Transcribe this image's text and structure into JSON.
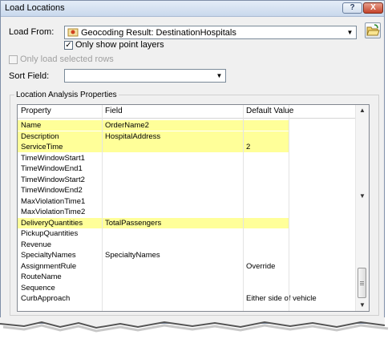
{
  "window": {
    "title": "Load Locations",
    "help": "?",
    "close": "X"
  },
  "load_from": {
    "label": "Load From:",
    "value": "Geocoding Result: DestinationHospitals",
    "only_point_layers_label": "Only show point layers",
    "only_point_layers_checked": true
  },
  "only_selected": {
    "label": "Only load selected rows",
    "checked": false,
    "enabled": false
  },
  "sort_field": {
    "label": "Sort Field:",
    "value": ""
  },
  "properties": {
    "group_title": "Location Analysis Properties",
    "columns": [
      "Property",
      "Field",
      "Default Value"
    ],
    "rows": [
      {
        "property": "Name",
        "field": "OrderName2",
        "default": "",
        "highlighted": true
      },
      {
        "property": "Description",
        "field": "HospitalAddress",
        "default": "",
        "highlighted": true
      },
      {
        "property": "ServiceTime",
        "field": "",
        "default": "2",
        "highlighted": true
      },
      {
        "property": "TimeWindowStart1",
        "field": "",
        "default": "",
        "highlighted": false
      },
      {
        "property": "TimeWindowEnd1",
        "field": "",
        "default": "",
        "highlighted": false
      },
      {
        "property": "TimeWindowStart2",
        "field": "",
        "default": "",
        "highlighted": false
      },
      {
        "property": "TimeWindowEnd2",
        "field": "",
        "default": "",
        "highlighted": false
      },
      {
        "property": "MaxViolationTime1",
        "field": "",
        "default": "",
        "highlighted": false
      },
      {
        "property": "MaxViolationTime2",
        "field": "",
        "default": "",
        "highlighted": false
      },
      {
        "property": "DeliveryQuantities",
        "field": "TotalPassengers",
        "default": "",
        "highlighted": true
      },
      {
        "property": "PickupQuantities",
        "field": "",
        "default": "",
        "highlighted": false
      },
      {
        "property": "Revenue",
        "field": "",
        "default": "",
        "highlighted": false
      },
      {
        "property": "SpecialtyNames",
        "field": "SpecialtyNames",
        "default": "",
        "highlighted": false
      },
      {
        "property": "AssignmentRule",
        "field": "",
        "default": "Override",
        "highlighted": false
      },
      {
        "property": "RouteName",
        "field": "",
        "default": "",
        "highlighted": false
      },
      {
        "property": "Sequence",
        "field": "",
        "default": "",
        "highlighted": false
      },
      {
        "property": "CurbApproach",
        "field": "",
        "default": "Either side of vehicle",
        "highlighted": false
      }
    ]
  },
  "colors": {
    "highlight": "#ffff99",
    "title_bar": "#c9d8ec",
    "dialog_bg": "#f0f0f0"
  },
  "icons": {
    "layer": "geocode-layer-icon",
    "open": "open-folder-icon"
  }
}
